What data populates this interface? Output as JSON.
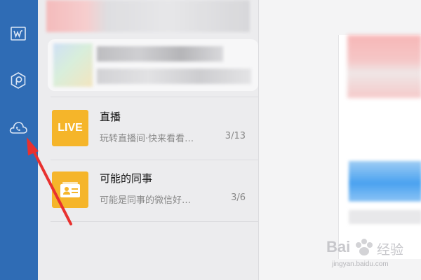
{
  "sidebar": {
    "items": [
      {
        "icon": "w-document-icon"
      },
      {
        "icon": "hexagon-p-icon"
      },
      {
        "icon": "cloud-phone-icon"
      }
    ]
  },
  "list": {
    "rows": [
      {
        "icon_text": "LIVE",
        "title": "直播",
        "subtitle": "玩转直播间·快来看看…",
        "count": "3/13"
      },
      {
        "icon_text": "",
        "title": "可能的同事",
        "subtitle": "可能是同事的微信好…",
        "count": "3/6"
      }
    ]
  },
  "watermark": {
    "brand": "Bai",
    "brand2": "经验",
    "url": "jingyan.baidu.com"
  },
  "colors": {
    "sidebar": "#2f6cb5",
    "accent_orange": "#f5b52a",
    "arrow": "#e8312f"
  }
}
